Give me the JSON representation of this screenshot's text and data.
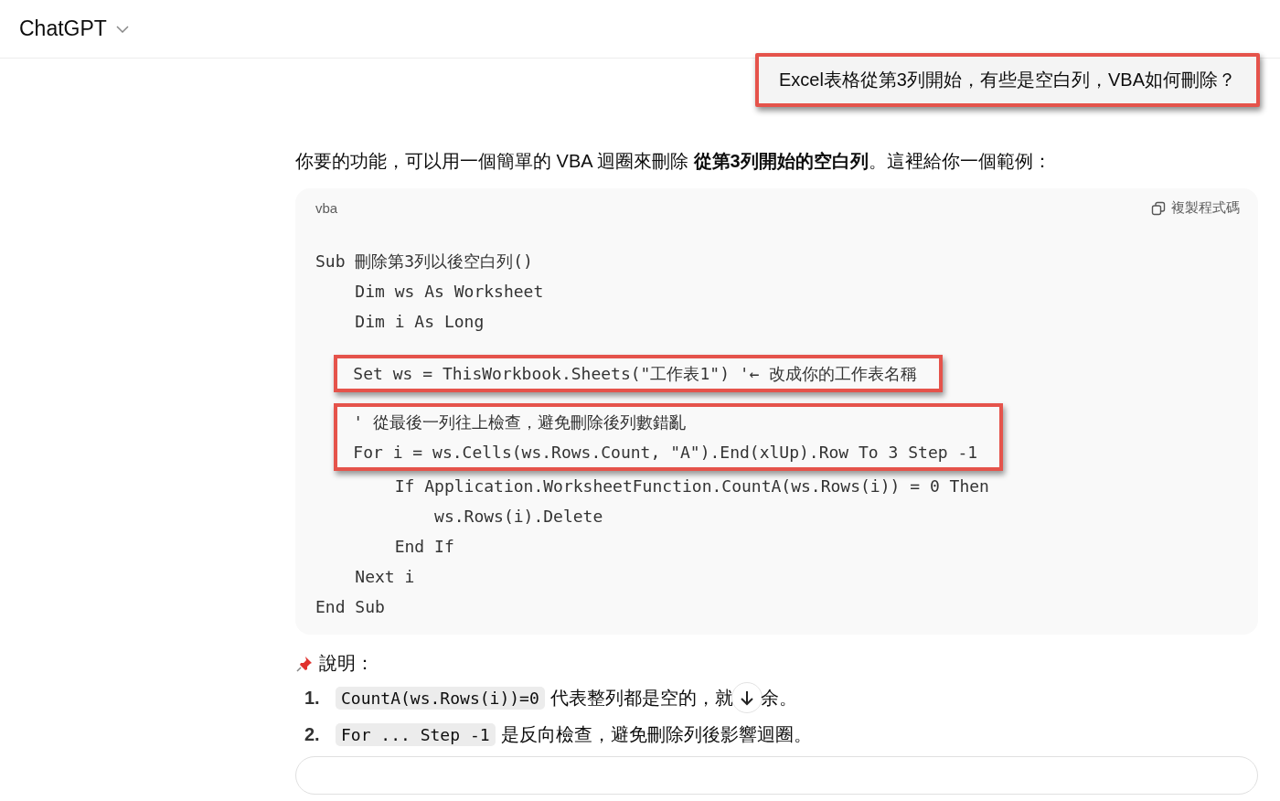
{
  "header": {
    "title": "ChatGPT"
  },
  "user_message": {
    "text": "Excel表格從第3列開始，有些是空白列，VBA如何刪除？",
    "highlighted": true
  },
  "reply": {
    "intro": "你要的功能，可以用一個簡單的 VBA 迴圈來刪除 **從第3列開始的空白列**。這裡給你一個範例：",
    "code": {
      "language": "vba",
      "copy_label": "複製程式碼",
      "groups": [
        {
          "highlighted": false,
          "lines": [
            "Sub 刪除第3列以後空白列()",
            "    Dim ws As Worksheet",
            "    Dim i As Long"
          ]
        },
        {
          "highlighted": true,
          "lines": [
            "    Set ws = ThisWorkbook.Sheets(\"工作表1\") '← 改成你的工作表名稱"
          ]
        },
        {
          "highlighted": true,
          "lines": [
            "    ' 從最後一列往上檢查，避免刪除後列數錯亂",
            "    For i = ws.Cells(ws.Rows.Count, \"A\").End(xlUp).Row To 3 Step -1"
          ]
        },
        {
          "highlighted": false,
          "lines": [
            "        If Application.WorksheetFunction.CountA(ws.Rows(i)) = 0 Then",
            "            ws.Rows(i).Delete",
            "        End If",
            "    Next i",
            "End Sub"
          ]
        }
      ]
    },
    "notes_heading": "說明：",
    "notes": [
      {
        "number": "1.",
        "code": "CountA(ws.Rows(i))=0",
        "text": "代表整列都是空的，就",
        "text_after": "余。"
      },
      {
        "number": "2.",
        "code": "For ... Step -1",
        "text": "是反向檢查，避免刪除列後影響迴圈。"
      }
    ]
  }
}
